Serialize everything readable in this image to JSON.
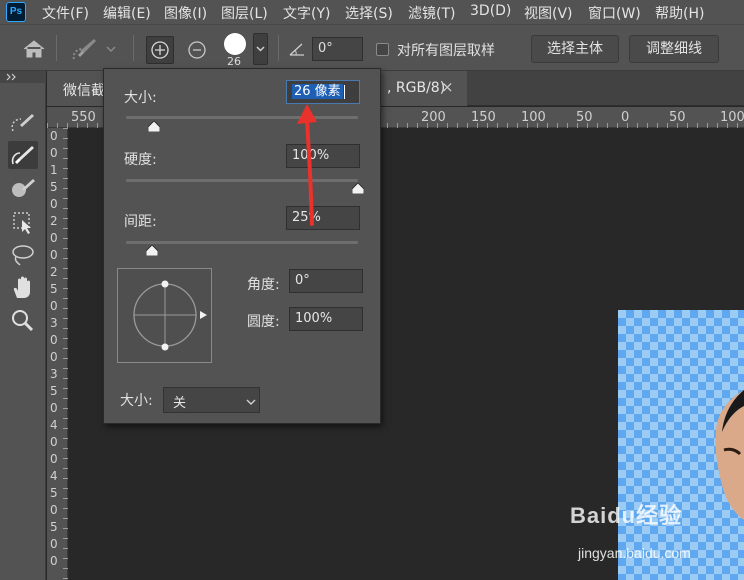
{
  "app": {
    "logo": "Ps"
  },
  "menu": [
    {
      "label": "文件(F)"
    },
    {
      "label": "编辑(E)"
    },
    {
      "label": "图像(I)"
    },
    {
      "label": "图层(L)"
    },
    {
      "label": "文字(Y)"
    },
    {
      "label": "选择(S)"
    },
    {
      "label": "滤镜(T)"
    },
    {
      "label": "3D(D)"
    },
    {
      "label": "视图(V)"
    },
    {
      "label": "窗口(W)"
    },
    {
      "label": "帮助(H)"
    }
  ],
  "options": {
    "brush_size": "26",
    "angle": "0°",
    "sample_all_layers_label": "对所有图层取样",
    "select_subject_label": "选择主体",
    "refine_edge_label": "调整细线"
  },
  "tab": {
    "title_left": "微信截",
    "title_right": ", RGB/8)",
    "close": "×"
  },
  "hruler": [
    "550",
    "250",
    "200",
    "150",
    "100",
    "50",
    "0",
    "50",
    "100"
  ],
  "vruler": [
    "0",
    "0",
    "1",
    "5",
    "0",
    "2",
    "0",
    "0",
    "2",
    "5",
    "0",
    "3",
    "0",
    "0",
    "3",
    "5",
    "0",
    "4",
    "0",
    "0",
    "4",
    "5",
    "0",
    "5",
    "0",
    "0"
  ],
  "popup": {
    "size_label": "大小:",
    "size_value": "26 像素",
    "hardness_label": "硬度:",
    "hardness_value": "100%",
    "spacing_label": "间距:",
    "spacing_value": "25%",
    "angle_label": "角度:",
    "angle_value": "0°",
    "roundness_label": "圆度:",
    "roundness_value": "100%",
    "pressure_label": "大小:",
    "pressure_value": "关",
    "sliders": {
      "size": 0.12,
      "hardness": 1.0,
      "spacing": 0.11
    }
  },
  "watermark": {
    "brand": "Baidu经验",
    "url": "jingyan.baidu.com"
  },
  "colors": {
    "accent_selection": "#1e5fb4",
    "annotation_arrow": "#e8322b",
    "transparency_grid": "#5fa8f0"
  }
}
